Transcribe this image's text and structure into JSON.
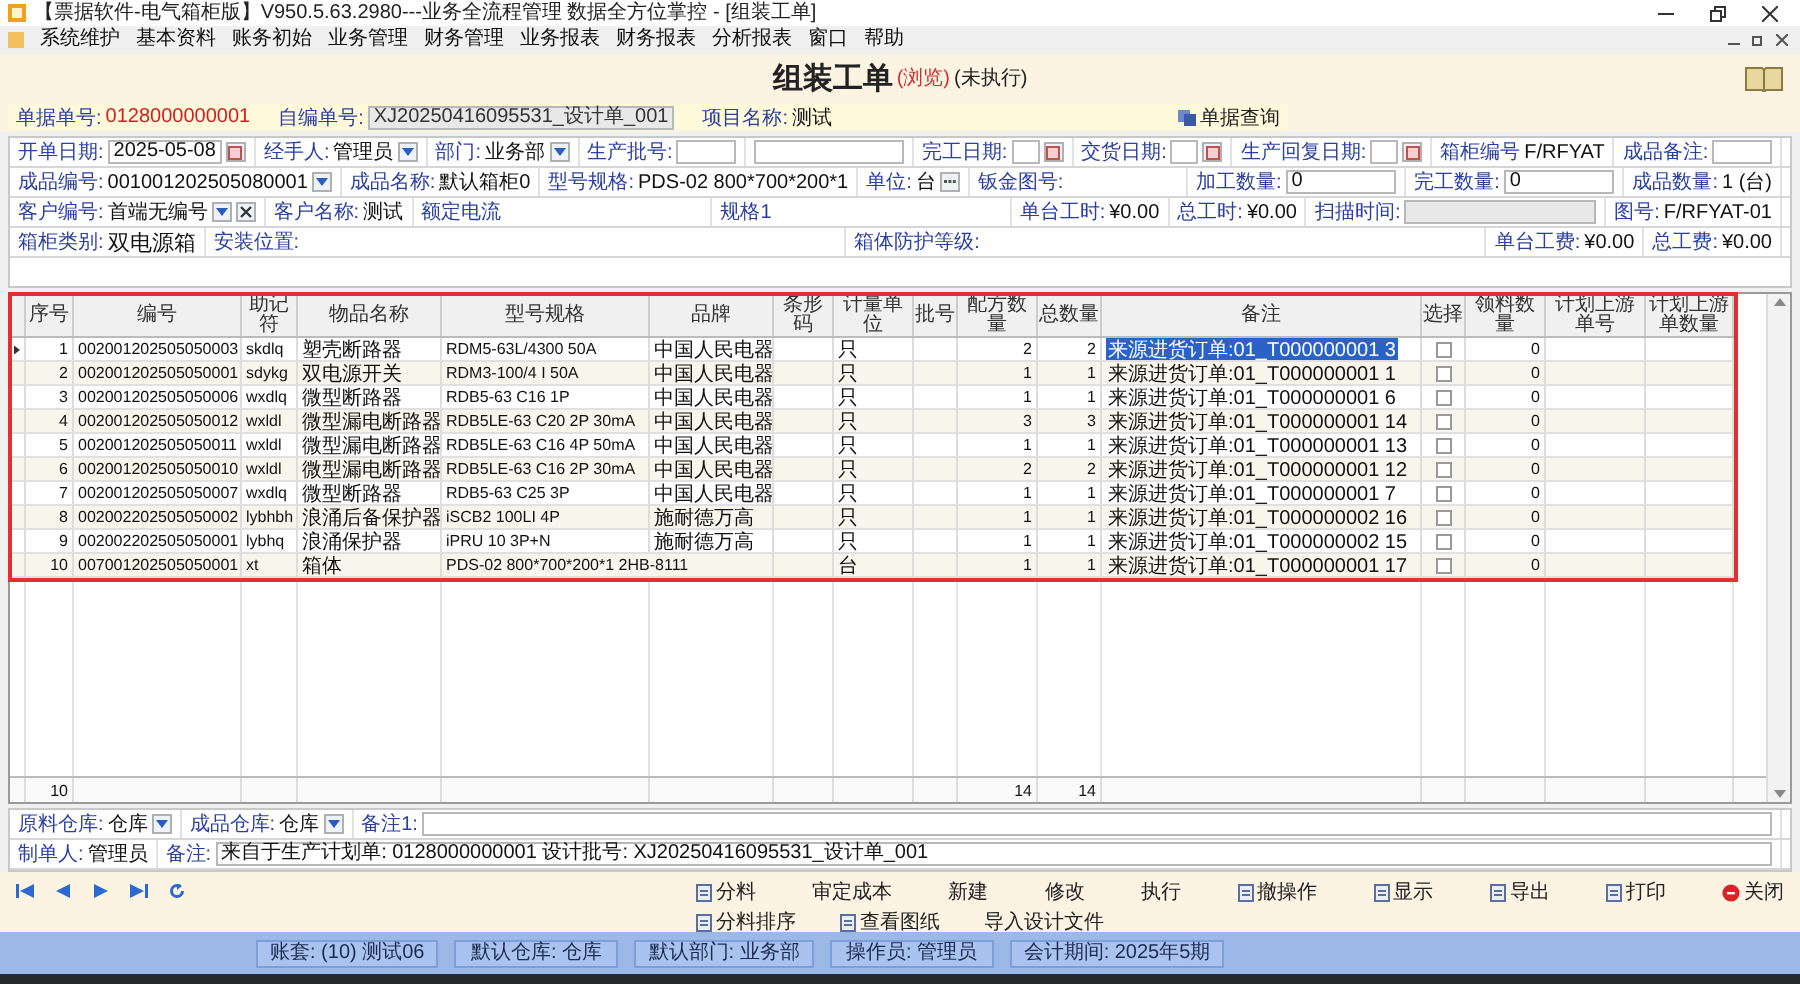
{
  "window": {
    "title": "【票据软件-电气箱柜版】V950.5.63.2980---业务全流程管理 数据全方位掌控 - [组装工单]"
  },
  "menu": [
    "系统维护",
    "基本资料",
    "账务初始",
    "业务管理",
    "财务管理",
    "业务报表",
    "财务报表",
    "分析报表",
    "窗口",
    "帮助"
  ],
  "document": {
    "title": "组装工单",
    "mode": "(浏览)",
    "status": "(未执行)"
  },
  "header_strip": {
    "fields": [
      {
        "label": "单据单号:",
        "value": "0128000000001",
        "kind": "text"
      },
      {
        "label": "自编单号:",
        "value": "XJ20250416095531_设计单_001",
        "kind": "disabled"
      },
      {
        "label": "项目名称:",
        "value": "测试",
        "kind": "text"
      }
    ],
    "query_button": "单据查询"
  },
  "form": {
    "rows": [
      {
        "items": [
          {
            "label": "开单日期:",
            "value": "2025-05-08",
            "kind": "date"
          },
          {
            "label": "经手人:",
            "value": "管理员",
            "kind": "select"
          },
          {
            "label": "部门:",
            "value": "业务部",
            "kind": "select"
          },
          {
            "label": "生产批号:",
            "kind": "field"
          },
          {
            "kind": "field"
          },
          {
            "label": "完工日期:",
            "kind": "date"
          },
          {
            "label": "交货日期:",
            "kind": "date"
          },
          {
            "label": "生产回复日期:",
            "kind": "date"
          },
          {
            "label": "箱柜编号",
            "value": "F/RFYAT",
            "kind": "text"
          },
          {
            "label": "成品备注:",
            "kind": "field"
          }
        ]
      },
      {
        "items": [
          {
            "label": "成品编号:",
            "value": "001001202505080001",
            "kind": "select"
          },
          {
            "label": "成品名称:",
            "value": "默认箱柜0",
            "kind": "text"
          },
          {
            "label": "型号规格:",
            "value": "PDS-02 800*700*200*1",
            "kind": "text"
          },
          {
            "label": "单位:",
            "value": "台",
            "kind": "more"
          },
          {
            "label": "钣金图号:",
            "kind": "text"
          },
          {
            "label": "加工数量:",
            "value": "0",
            "kind": "field"
          },
          {
            "label": "完工数量:",
            "value": "0",
            "kind": "field"
          },
          {
            "label": "成品数量:",
            "value": "1 (台)",
            "kind": "text"
          }
        ]
      },
      {
        "items": [
          {
            "label": "客户编号:",
            "value": "首端无编号",
            "kind": "select_clear"
          },
          {
            "label": "客户名称:",
            "value": "测试",
            "kind": "text"
          },
          {
            "label": "额定电流",
            "kind": "text"
          },
          {
            "label": "规格1",
            "kind": "text"
          },
          {
            "label": "单台工时:",
            "value": "¥0.00",
            "kind": "text"
          },
          {
            "label": "总工时:",
            "value": "¥0.00",
            "kind": "text"
          },
          {
            "label": "扫描时间:",
            "kind": "disabled"
          },
          {
            "label": "图号:",
            "value": "F/RFYAT-01",
            "kind": "text"
          }
        ]
      },
      {
        "items": [
          {
            "label": "箱柜类别:",
            "value": "双电源箱",
            "kind": "text"
          },
          {
            "label": "安装位置:",
            "kind": "text"
          },
          {
            "label": "箱体防护等级:",
            "kind": "text"
          },
          {
            "label": "单台工费:",
            "value": "¥0.00",
            "kind": "text"
          },
          {
            "label": "总工费:",
            "value": "¥0.00",
            "kind": "text"
          }
        ]
      }
    ]
  },
  "table": {
    "columns": [
      "序号",
      "编号",
      "助记符",
      "物品名称",
      "型号规格",
      "品牌",
      "条形码",
      "计量单位",
      "批号",
      "配方数量",
      "总数量",
      "备注",
      "选择",
      "领料数量",
      "计划上游单号",
      "计划上游单数量"
    ],
    "rows": [
      {
        "no": "1",
        "code": "002001202505050003",
        "mnemonic": "skdlq",
        "name": "塑壳断路器",
        "spec": "RDM5-63L/4300 50A",
        "brand": "中国人民电器",
        "unit": "只",
        "formula_qty": "2",
        "total_qty": "2",
        "note": "来源进货订单:01_T000000001 3",
        "checked": false,
        "pick_qty": "0",
        "selected": true
      },
      {
        "no": "2",
        "code": "002001202505050001",
        "mnemonic": "sdykg",
        "name": "双电源开关",
        "spec": "RDM3-100/4 I 50A",
        "brand": "中国人民电器",
        "unit": "只",
        "formula_qty": "1",
        "total_qty": "1",
        "note": "来源进货订单:01_T000000001 1",
        "checked": false,
        "pick_qty": "0",
        "selected": false
      },
      {
        "no": "3",
        "code": "002001202505050006",
        "mnemonic": "wxdlq",
        "name": "微型断路器",
        "spec": "RDB5-63 C16 1P",
        "brand": "中国人民电器",
        "unit": "只",
        "formula_qty": "1",
        "total_qty": "1",
        "note": "来源进货订单:01_T000000001 6",
        "checked": false,
        "pick_qty": "0",
        "selected": false
      },
      {
        "no": "4",
        "code": "002001202505050012",
        "mnemonic": "wxldl",
        "name": "微型漏电断路器",
        "spec": "RDB5LE-63 C20 2P 30mA",
        "brand": "中国人民电器",
        "unit": "只",
        "formula_qty": "3",
        "total_qty": "3",
        "note": "来源进货订单:01_T000000001 14",
        "checked": false,
        "pick_qty": "0",
        "selected": false
      },
      {
        "no": "5",
        "code": "002001202505050011",
        "mnemonic": "wxldl",
        "name": "微型漏电断路器",
        "spec": "RDB5LE-63 C16 4P 50mA",
        "brand": "中国人民电器",
        "unit": "只",
        "formula_qty": "1",
        "total_qty": "1",
        "note": "来源进货订单:01_T000000001 13",
        "checked": false,
        "pick_qty": "0",
        "selected": false
      },
      {
        "no": "6",
        "code": "002001202505050010",
        "mnemonic": "wxldl",
        "name": "微型漏电断路器",
        "spec": "RDB5LE-63 C16 2P 30mA",
        "brand": "中国人民电器",
        "unit": "只",
        "formula_qty": "2",
        "total_qty": "2",
        "note": "来源进货订单:01_T000000001 12",
        "checked": false,
        "pick_qty": "0",
        "selected": false
      },
      {
        "no": "7",
        "code": "002001202505050007",
        "mnemonic": "wxdlq",
        "name": "微型断路器",
        "spec": "RDB5-63 C25 3P",
        "brand": "中国人民电器",
        "unit": "只",
        "formula_qty": "1",
        "total_qty": "1",
        "note": "来源进货订单:01_T000000001 7",
        "checked": false,
        "pick_qty": "0",
        "selected": false
      },
      {
        "no": "8",
        "code": "002002202505050002",
        "mnemonic": "lybhbh",
        "name": "浪涌后备保护器",
        "spec": "iSCB2 100LI 4P",
        "brand": "施耐德万高",
        "unit": "只",
        "formula_qty": "1",
        "total_qty": "1",
        "note": "来源进货订单:01_T000000002 16",
        "checked": false,
        "pick_qty": "0",
        "selected": false
      },
      {
        "no": "9",
        "code": "002002202505050001",
        "mnemonic": "lybhq",
        "name": "浪涌保护器",
        "spec": "iPRU 10 3P+N",
        "brand": "施耐德万高",
        "unit": "只",
        "formula_qty": "1",
        "total_qty": "1",
        "note": "来源进货订单:01_T000000002 15",
        "checked": false,
        "pick_qty": "0",
        "selected": false
      },
      {
        "no": "10",
        "code": "007001202505050001",
        "mnemonic": "xt",
        "name": "箱体",
        "spec": "PDS-02 800*700*200*1 2HB-8111",
        "unit": "台",
        "formula_qty": "1",
        "total_qty": "1",
        "note": "来源进货订单:01_T000000001 17",
        "checked": false,
        "pick_qty": "0",
        "selected": false
      }
    ],
    "total": {
      "no": "10",
      "formula_qty": "14",
      "total_qty": "14"
    }
  },
  "footer": {
    "rows": [
      {
        "items": [
          {
            "label": "原料仓库:",
            "value": "仓库",
            "kind": "select"
          },
          {
            "label": "成品仓库:",
            "value": "仓库",
            "kind": "select"
          },
          {
            "label": "备注1:",
            "kind": "field"
          }
        ]
      },
      {
        "items": [
          {
            "label": "制单人:",
            "value": "管理员",
            "kind": "text"
          },
          {
            "label": "备注:",
            "value": "来自于生产计划单: 0128000000001 设计批号: XJ20250416095531_设计单_001",
            "kind": "field"
          }
        ]
      }
    ]
  },
  "toolbar": [
    [
      {
        "label": "分料",
        "icon": true
      },
      {
        "label": "审定成本",
        "icon": false
      },
      {
        "label": "新建",
        "icon": false
      },
      {
        "label": "修改",
        "icon": false
      },
      {
        "label": "执行",
        "icon": false
      },
      {
        "label": "撤操作",
        "icon": true
      },
      {
        "label": "显示",
        "icon": true
      },
      {
        "label": "导出",
        "icon": true
      },
      {
        "label": "打印",
        "icon": true
      },
      {
        "label": "关闭",
        "icon": true
      }
    ],
    [
      {
        "label": "分料排序",
        "icon": true
      },
      {
        "label": "查看图纸",
        "icon": true
      },
      {
        "label": "导入设计文件",
        "icon": false
      }
    ]
  ],
  "status_bar": [
    "账套: (10) 测试06",
    "默认仓库: 仓库",
    "默认部门: 业务部",
    "操作员: 管理员",
    "会计期间: 2025年5期"
  ]
}
